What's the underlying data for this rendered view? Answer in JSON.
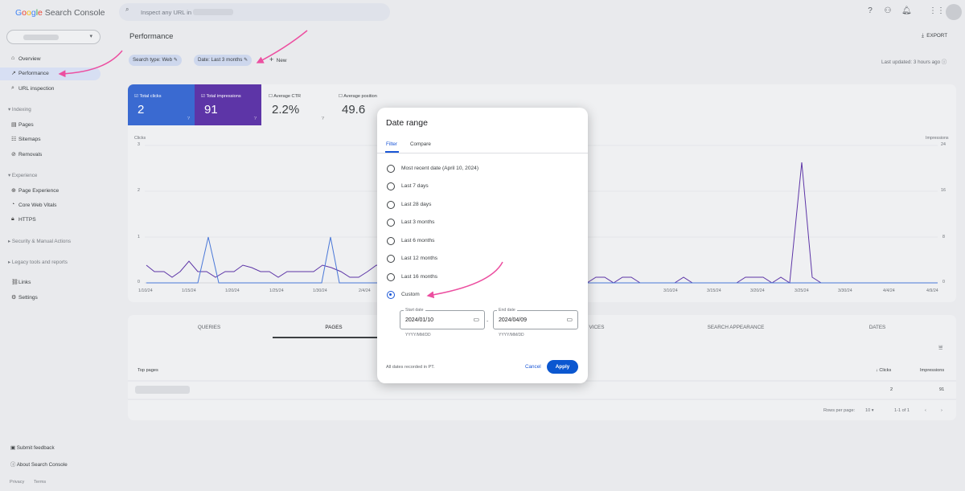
{
  "topbar": {
    "logo": {
      "g1": "G",
      "g2": "o",
      "g3": "o",
      "g4": "g",
      "g5": "l",
      "g6": "e",
      "rest": " Search Console"
    },
    "search_placeholder": "Inspect any URL in"
  },
  "sidebar": {
    "items": [
      {
        "label": "Overview",
        "icon": "home-icon"
      },
      {
        "label": "Performance",
        "icon": "trending-icon"
      },
      {
        "label": "URL inspection",
        "icon": "search-icon"
      }
    ],
    "sections": {
      "indexing": "Indexing",
      "experience": "Experience",
      "security": "Security & Manual Actions",
      "legacy": "Legacy tools and reports"
    },
    "indexing_items": [
      {
        "label": "Pages"
      },
      {
        "label": "Sitemaps"
      },
      {
        "label": "Removals"
      }
    ],
    "experience_items": [
      {
        "label": "Page Experience"
      },
      {
        "label": "Core Web Vitals"
      },
      {
        "label": "HTTPS"
      }
    ],
    "other_items": [
      {
        "label": "Links"
      },
      {
        "label": "Settings"
      }
    ],
    "footer": {
      "feedback": "Submit feedback",
      "about": "About Search Console",
      "privacy": "Privacy",
      "terms": "Terms"
    }
  },
  "main": {
    "title": "Performance",
    "export": "EXPORT",
    "filters": {
      "search_type": "Search type: Web",
      "date": "Date: Last 3 months",
      "new": "New"
    },
    "last_updated": "Last updated: 3 hours ago",
    "metrics": [
      {
        "label": "Total clicks",
        "value": "2"
      },
      {
        "label": "Total impressions",
        "value": "91"
      },
      {
        "label": "Average CTR",
        "value": "2.2%"
      },
      {
        "label": "Average position",
        "value": "49.6"
      }
    ],
    "chart_data": {
      "type": "line",
      "ylabel_left": "Clicks",
      "ylabel_right": "Impressions",
      "y_left_ticks": [
        "3",
        "2",
        "1",
        "0"
      ],
      "y_right_ticks": [
        "24",
        "16",
        "8",
        "0"
      ],
      "ylim_left": [
        0,
        3
      ],
      "ylim_right": [
        0,
        24
      ],
      "x_ticks": [
        "1/10/24",
        "1/15/24",
        "1/20/24",
        "1/25/24",
        "1/30/24",
        "2/4/24",
        "3/10/24",
        "3/15/24",
        "3/20/24",
        "3/25/24",
        "3/30/24",
        "4/4/24",
        "4/9/24"
      ],
      "grid": true,
      "series": [
        {
          "name": "Clicks",
          "color": "#4a78d8"
        },
        {
          "name": "Impressions",
          "color": "#5d35a7"
        }
      ]
    },
    "tabs": [
      "QUERIES",
      "PAGES",
      "VICES",
      "SEARCH APPEARANCE",
      "DATES"
    ],
    "table": {
      "col_page": "Top pages",
      "col_clicks": "Clicks",
      "col_impr": "Impressions",
      "row_clicks": "2",
      "row_impr": "91"
    },
    "pager": {
      "rows_label": "Rows per page:",
      "rows_value": "10",
      "range": "1-1 of 1"
    }
  },
  "dialog": {
    "title": "Date range",
    "tabs": {
      "filter": "Filter",
      "compare": "Compare"
    },
    "options": [
      "Most recent date (April 10, 2024)",
      "Last 7 days",
      "Last 28 days",
      "Last 3 months",
      "Last 6 months",
      "Last 12 months",
      "Last 16 months",
      "Custom"
    ],
    "selected_index": 7,
    "start": {
      "label": "Start date",
      "value": "2024/01/10",
      "hint": "YYYY/MM/DD"
    },
    "end": {
      "label": "End date",
      "value": "2024/04/09",
      "hint": "YYYY/MM/DD"
    },
    "timezone_note": "All dates recorded in PT.",
    "cancel": "Cancel",
    "apply": "Apply"
  },
  "colors": {
    "accent_blue": "#0b57d0",
    "clicks_blue": "#3a6ad1",
    "impressions_purple": "#5d35a7",
    "annotation_pink": "#ec4fa0"
  }
}
